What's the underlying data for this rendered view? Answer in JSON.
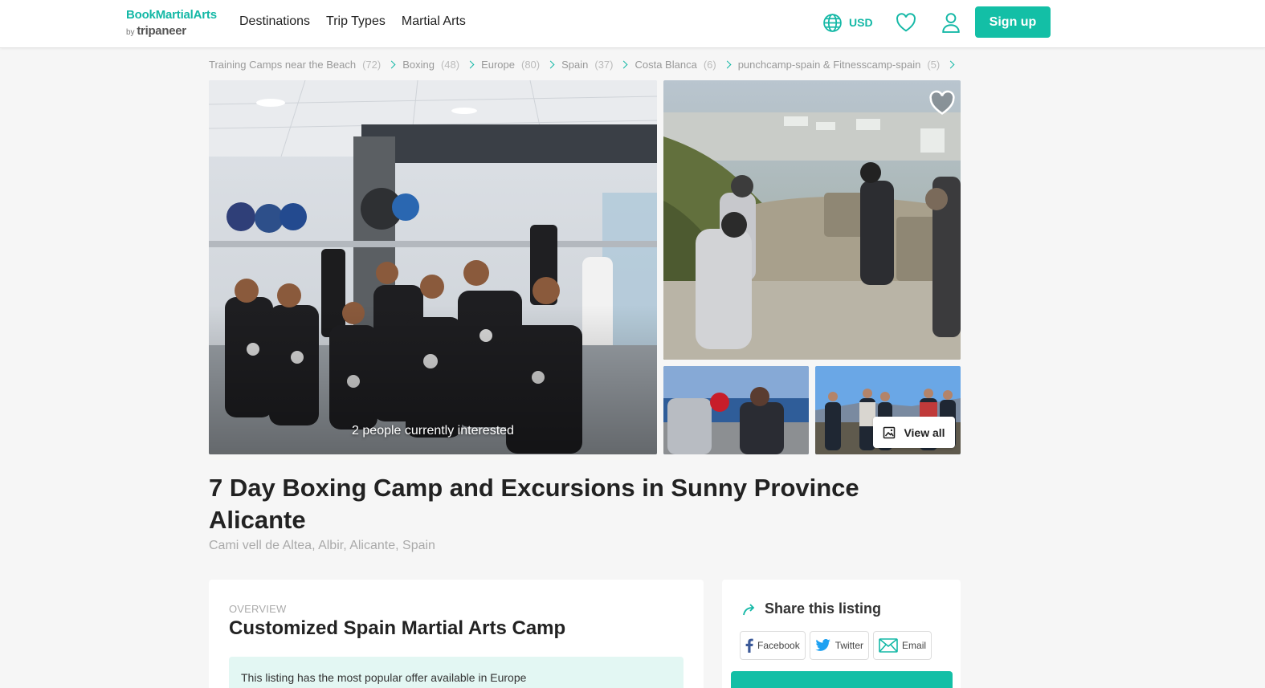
{
  "header": {
    "logo_main": "BookMartialArts",
    "logo_by": "by",
    "logo_brand": "tripaneer",
    "nav": [
      "Destinations",
      "Trip Types",
      "Martial Arts"
    ],
    "currency": "USD",
    "signup_label": "Sign up"
  },
  "breadcrumb": [
    {
      "label": "Training Camps near the Beach",
      "count": "(72)"
    },
    {
      "label": "Boxing",
      "count": "(48)"
    },
    {
      "label": "Europe",
      "count": "(80)"
    },
    {
      "label": "Spain",
      "count": "(37)"
    },
    {
      "label": "Costa Blanca",
      "count": "(6)"
    },
    {
      "label": "punchcamp-spain & Fitnesscamp-spain",
      "count": "(5)"
    }
  ],
  "gallery": {
    "interested_text": "2 people currently interested",
    "view_all_label": "View all"
  },
  "listing": {
    "title": "7 Day Boxing Camp and Excursions in Sunny Province Alicante",
    "address": "Cami vell de Altea, Albir, Alicante, Spain"
  },
  "overview": {
    "label": "OVERVIEW",
    "heading": "Customized Spain Martial Arts Camp",
    "note": "This listing has the most popular offer available in Europe"
  },
  "share": {
    "title": "Share this listing",
    "buttons": [
      "Facebook",
      "Twitter",
      "Email"
    ]
  },
  "colors": {
    "brand": "#13bfa6",
    "text": "#222222",
    "muted": "#aaaaaa"
  },
  "icons": [
    "globe-icon",
    "heart-icon",
    "user-icon",
    "image-icon",
    "share-icon",
    "facebook-icon",
    "twitter-icon",
    "email-icon",
    "chevron-right-icon"
  ]
}
